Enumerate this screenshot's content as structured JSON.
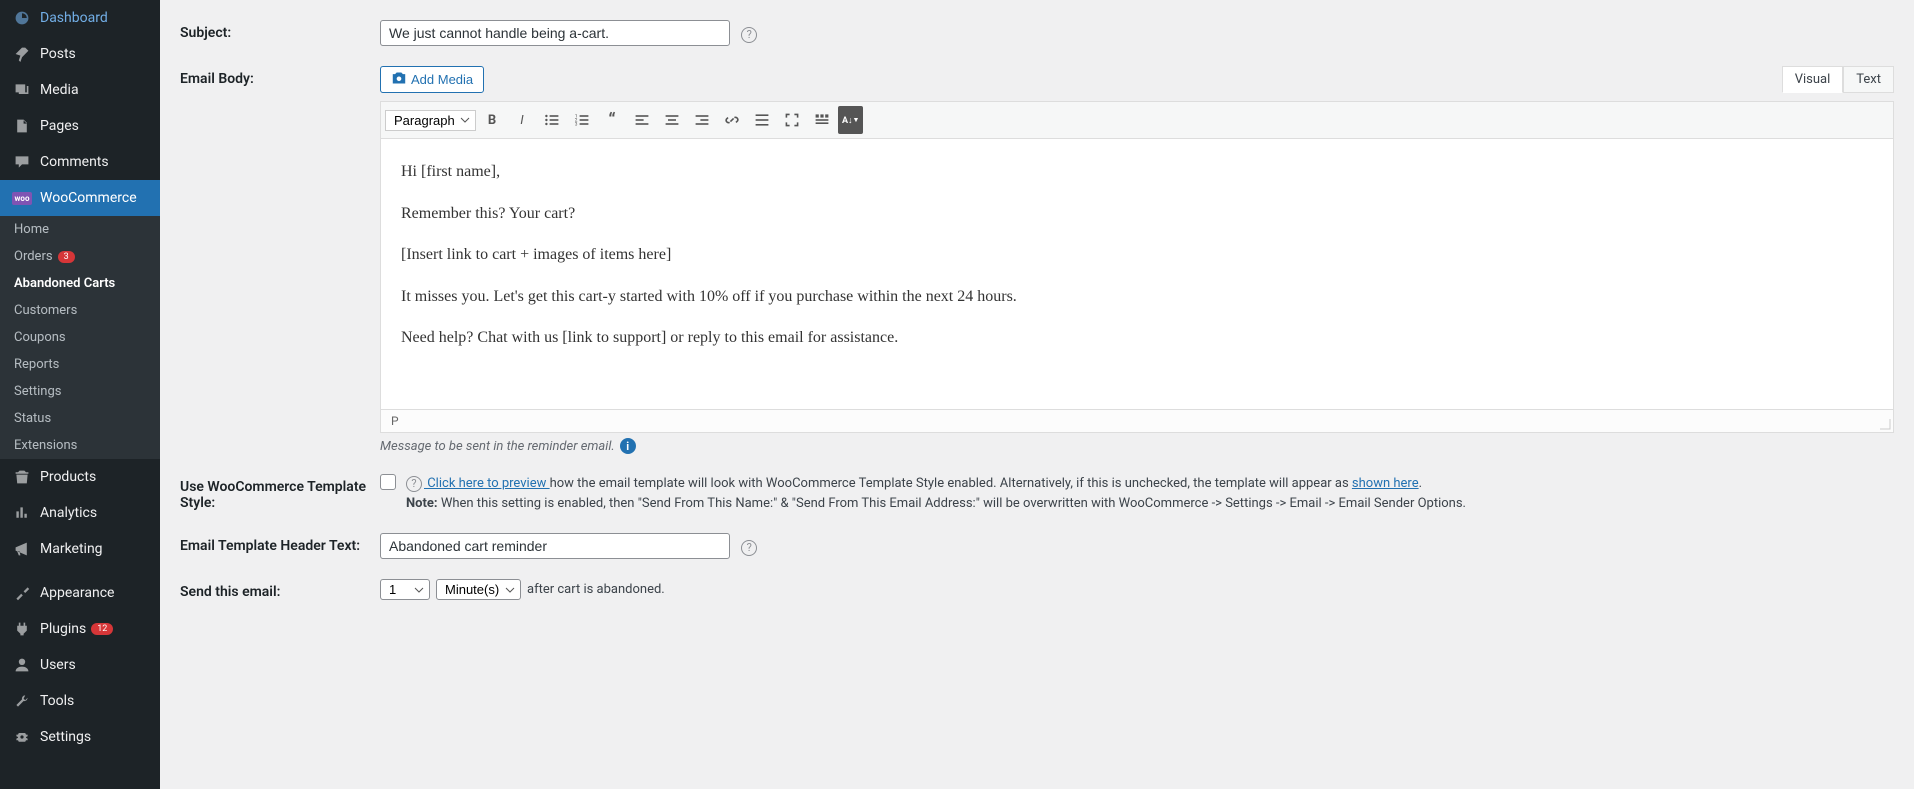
{
  "sidebar": {
    "dashboard": "Dashboard",
    "posts": "Posts",
    "media": "Media",
    "pages": "Pages",
    "comments": "Comments",
    "woocommerce": "WooCommerce",
    "products": "Products",
    "analytics": "Analytics",
    "marketing": "Marketing",
    "appearance": "Appearance",
    "plugins": "Plugins",
    "plugins_badge": "12",
    "users": "Users",
    "tools": "Tools",
    "settings": "Settings"
  },
  "submenu": {
    "home": "Home",
    "orders": "Orders",
    "orders_badge": "3",
    "abandoned_carts": "Abandoned Carts",
    "customers": "Customers",
    "coupons": "Coupons",
    "reports": "Reports",
    "settings": "Settings",
    "status": "Status",
    "extensions": "Extensions"
  },
  "form": {
    "subject_label": "Subject:",
    "subject_value": "We just cannot handle being a-cart.",
    "email_body_label": "Email Body:",
    "add_media": "Add Media",
    "format": "Paragraph",
    "tab_visual": "Visual",
    "tab_text": "Text",
    "body_p1": "Hi [first name],",
    "body_p2": "Remember this? Your cart?",
    "body_p3": "[Insert link to cart + images of items here]",
    "body_p4": "It misses you. Let's get this cart-y started with 10% off if you purchase within the next 24 hours.",
    "body_p5": "Need help? Chat with us [link to support] or reply to this email for assistance.",
    "footer_path": "P",
    "help_text": "Message to be sent in the reminder email.",
    "template_label": "Use WooCommerce Template Style:",
    "template_link1": " Click here to preview ",
    "template_desc1": "how the email template will look with WooCommerce Template Style enabled. Alternatively, if this is unchecked, the template will appear as ",
    "template_link2": "shown here",
    "template_note_label": "Note:",
    "template_note": " When this setting is enabled, then \"Send From This Name:\" & \"Send From This Email Address:\" will be overwritten with WooCommerce -> Settings -> Email -> Email Sender Options.",
    "header_text_label": "Email Template Header Text:",
    "header_text_value": "Abandoned cart reminder",
    "send_label": "Send this email:",
    "send_number": "1",
    "send_unit": "Minute(s)",
    "send_after": "after cart is abandoned."
  }
}
